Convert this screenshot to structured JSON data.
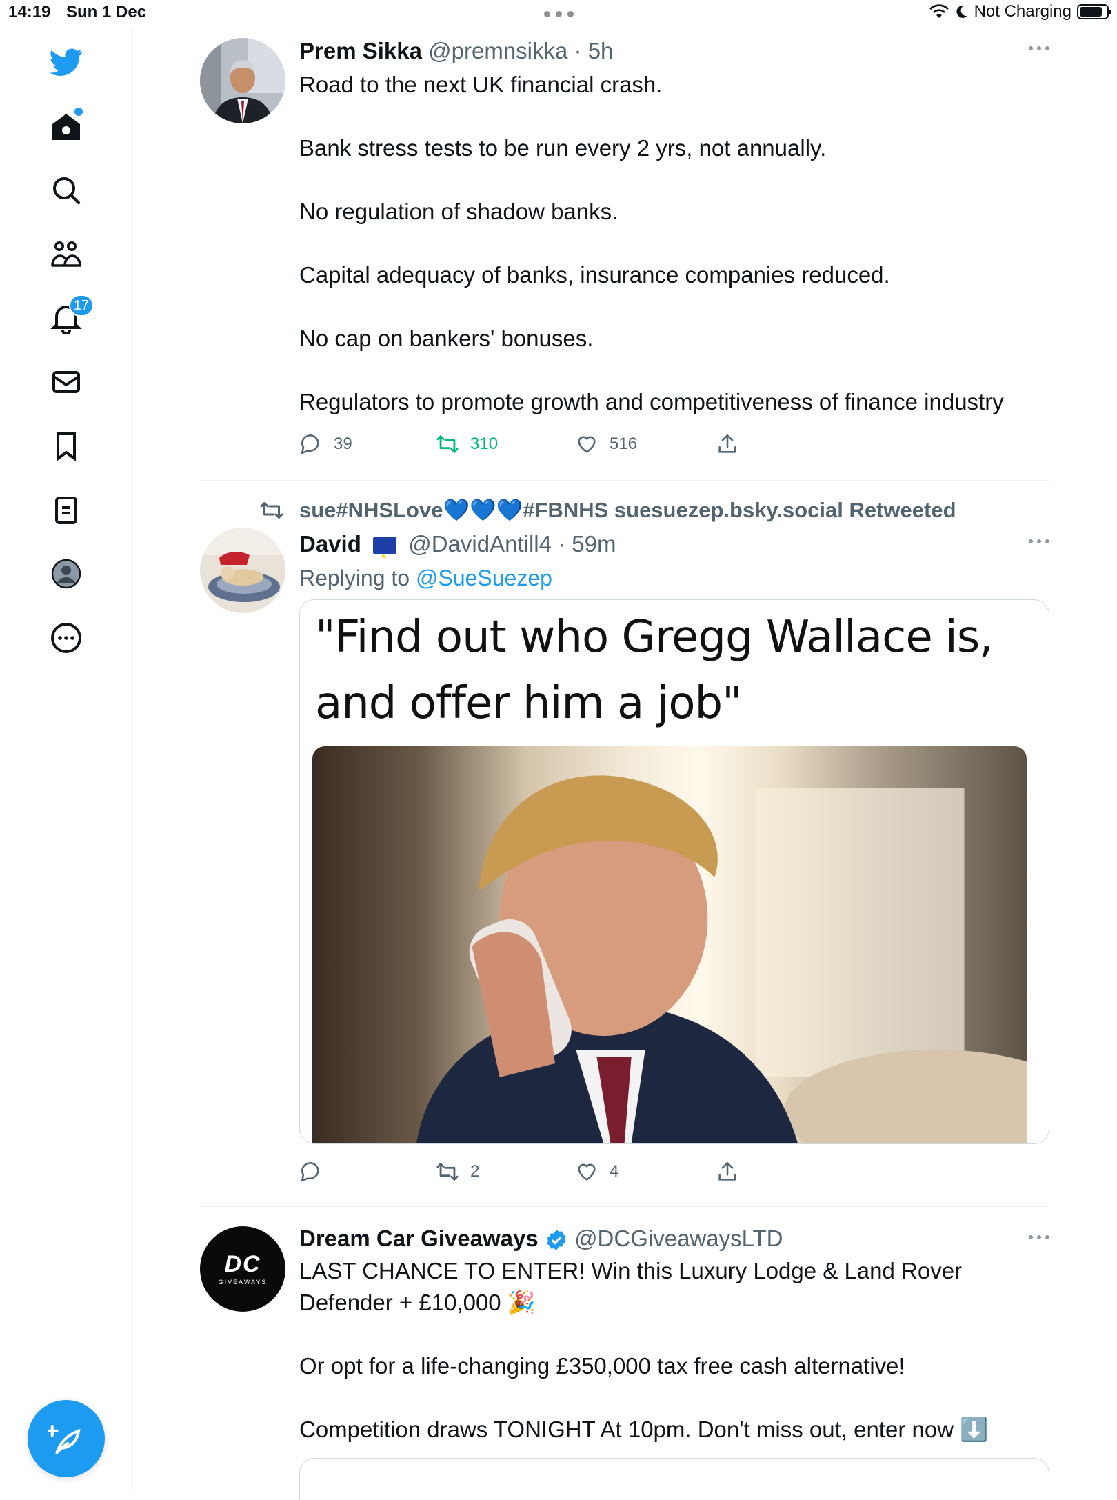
{
  "status_bar": {
    "time": "14:19",
    "date": "Sun 1 Dec",
    "charging": "Not Charging"
  },
  "colors": {
    "accent": "#1d9bf0",
    "retweet_active": "#00ba7c",
    "secondary_text": "#536471"
  },
  "sidebar": {
    "items": [
      {
        "name": "twitter-logo",
        "icon": "bird-icon"
      },
      {
        "name": "home",
        "icon": "home-icon",
        "has_dot": true
      },
      {
        "name": "explore",
        "icon": "search-icon"
      },
      {
        "name": "communities",
        "icon": "people-icon"
      },
      {
        "name": "notifications",
        "icon": "bell-icon",
        "badge": "17"
      },
      {
        "name": "messages",
        "icon": "mail-icon"
      },
      {
        "name": "bookmarks",
        "icon": "bookmark-icon"
      },
      {
        "name": "lists",
        "icon": "list-icon"
      },
      {
        "name": "profile",
        "icon": "avatar-icon"
      },
      {
        "name": "more",
        "icon": "more-circle-icon"
      }
    ],
    "compose_icon": "compose-feather-icon"
  },
  "tweets": [
    {
      "name": "Prem Sikka",
      "handle": "@premnsikka",
      "time": "5h",
      "paragraphs": [
        "Road to the next UK financial crash.",
        "Bank stress tests to be run every 2 yrs, not annually.",
        "No regulation of shadow banks.",
        "Capital adequacy of banks, insurance companies reduced.",
        "No cap on bankers' bonuses.",
        "Regulators to promote growth and competitiveness of finance industry"
      ],
      "replies": "39",
      "retweets": "310",
      "likes": "516"
    },
    {
      "retweeted_by": "sue#NHSLove💙💙💙#FBNHS suesuezep.bsky.social Retweeted",
      "name": "David",
      "handle": "@DavidAntill4",
      "time": "59m",
      "replying_label": "Replying to",
      "replying_to": "@SueSuezep",
      "quote_line1": "\"Find out who Gregg Wallace is,",
      "quote_line2": "and offer him a job\"",
      "replies": "",
      "retweets": "2",
      "likes": "4"
    },
    {
      "name": "Dream Car Giveaways",
      "handle": "@DCGiveawaysLTD",
      "avatar_logo": "DC",
      "avatar_sub": "GIVEAWAYS",
      "line1": "LAST CHANCE TO ENTER! Win this Luxury Lodge & Land Rover",
      "line2": "Defender + £10,000 🎉",
      "para2": "Or opt for a life-changing £350,000 tax free cash alternative!",
      "para3": "Competition draws TONIGHT At 10pm. Don't miss out, enter now ⬇️"
    }
  ]
}
